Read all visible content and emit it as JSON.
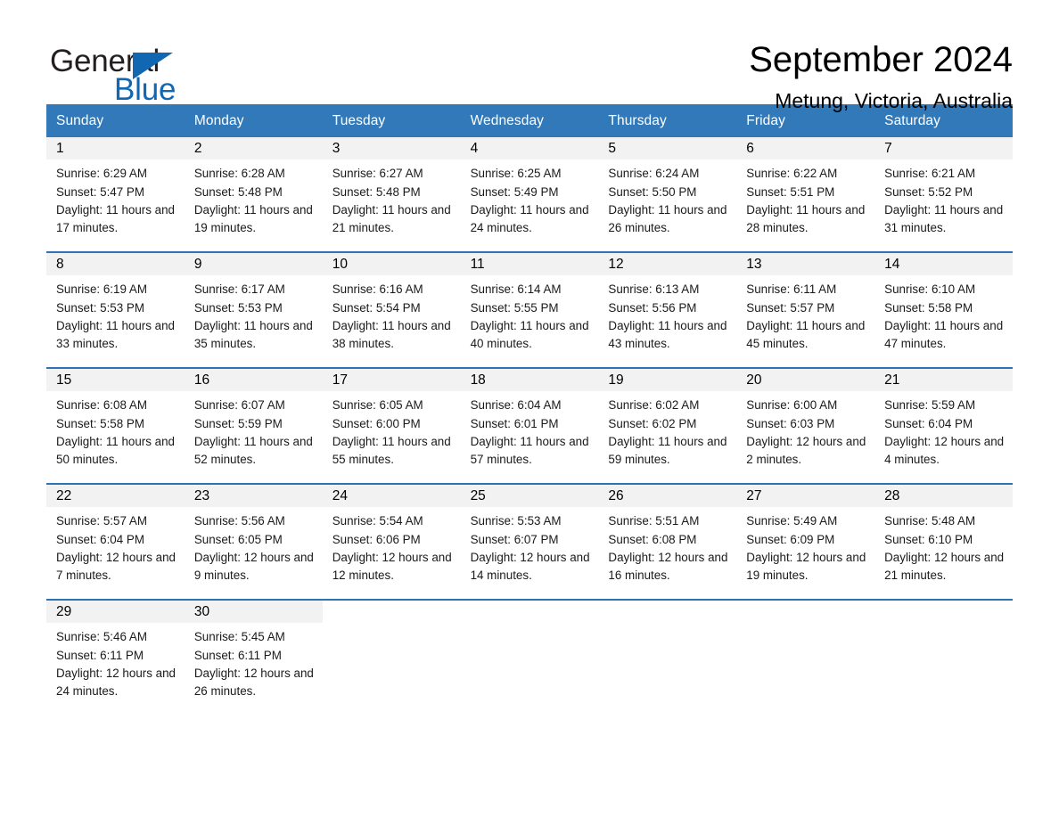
{
  "brand": {
    "name_part1": "General",
    "name_part2": "Blue",
    "triangle_color": "#1267b2"
  },
  "header": {
    "title": "September 2024",
    "location": "Metung, Victoria, Australia"
  },
  "theme": {
    "header_blue": "#3179b8",
    "row_border_blue": "#2e74b5",
    "date_band_gray": "#f2f2f2"
  },
  "calendar": {
    "weekdays": [
      "Sunday",
      "Monday",
      "Tuesday",
      "Wednesday",
      "Thursday",
      "Friday",
      "Saturday"
    ],
    "weeks": [
      [
        {
          "day": "1",
          "sunrise": "Sunrise: 6:29 AM",
          "sunset": "Sunset: 5:47 PM",
          "daylight": "Daylight: 11 hours and 17 minutes."
        },
        {
          "day": "2",
          "sunrise": "Sunrise: 6:28 AM",
          "sunset": "Sunset: 5:48 PM",
          "daylight": "Daylight: 11 hours and 19 minutes."
        },
        {
          "day": "3",
          "sunrise": "Sunrise: 6:27 AM",
          "sunset": "Sunset: 5:48 PM",
          "daylight": "Daylight: 11 hours and 21 minutes."
        },
        {
          "day": "4",
          "sunrise": "Sunrise: 6:25 AM",
          "sunset": "Sunset: 5:49 PM",
          "daylight": "Daylight: 11 hours and 24 minutes."
        },
        {
          "day": "5",
          "sunrise": "Sunrise: 6:24 AM",
          "sunset": "Sunset: 5:50 PM",
          "daylight": "Daylight: 11 hours and 26 minutes."
        },
        {
          "day": "6",
          "sunrise": "Sunrise: 6:22 AM",
          "sunset": "Sunset: 5:51 PM",
          "daylight": "Daylight: 11 hours and 28 minutes."
        },
        {
          "day": "7",
          "sunrise": "Sunrise: 6:21 AM",
          "sunset": "Sunset: 5:52 PM",
          "daylight": "Daylight: 11 hours and 31 minutes."
        }
      ],
      [
        {
          "day": "8",
          "sunrise": "Sunrise: 6:19 AM",
          "sunset": "Sunset: 5:53 PM",
          "daylight": "Daylight: 11 hours and 33 minutes."
        },
        {
          "day": "9",
          "sunrise": "Sunrise: 6:17 AM",
          "sunset": "Sunset: 5:53 PM",
          "daylight": "Daylight: 11 hours and 35 minutes."
        },
        {
          "day": "10",
          "sunrise": "Sunrise: 6:16 AM",
          "sunset": "Sunset: 5:54 PM",
          "daylight": "Daylight: 11 hours and 38 minutes."
        },
        {
          "day": "11",
          "sunrise": "Sunrise: 6:14 AM",
          "sunset": "Sunset: 5:55 PM",
          "daylight": "Daylight: 11 hours and 40 minutes."
        },
        {
          "day": "12",
          "sunrise": "Sunrise: 6:13 AM",
          "sunset": "Sunset: 5:56 PM",
          "daylight": "Daylight: 11 hours and 43 minutes."
        },
        {
          "day": "13",
          "sunrise": "Sunrise: 6:11 AM",
          "sunset": "Sunset: 5:57 PM",
          "daylight": "Daylight: 11 hours and 45 minutes."
        },
        {
          "day": "14",
          "sunrise": "Sunrise: 6:10 AM",
          "sunset": "Sunset: 5:58 PM",
          "daylight": "Daylight: 11 hours and 47 minutes."
        }
      ],
      [
        {
          "day": "15",
          "sunrise": "Sunrise: 6:08 AM",
          "sunset": "Sunset: 5:58 PM",
          "daylight": "Daylight: 11 hours and 50 minutes."
        },
        {
          "day": "16",
          "sunrise": "Sunrise: 6:07 AM",
          "sunset": "Sunset: 5:59 PM",
          "daylight": "Daylight: 11 hours and 52 minutes."
        },
        {
          "day": "17",
          "sunrise": "Sunrise: 6:05 AM",
          "sunset": "Sunset: 6:00 PM",
          "daylight": "Daylight: 11 hours and 55 minutes."
        },
        {
          "day": "18",
          "sunrise": "Sunrise: 6:04 AM",
          "sunset": "Sunset: 6:01 PM",
          "daylight": "Daylight: 11 hours and 57 minutes."
        },
        {
          "day": "19",
          "sunrise": "Sunrise: 6:02 AM",
          "sunset": "Sunset: 6:02 PM",
          "daylight": "Daylight: 11 hours and 59 minutes."
        },
        {
          "day": "20",
          "sunrise": "Sunrise: 6:00 AM",
          "sunset": "Sunset: 6:03 PM",
          "daylight": "Daylight: 12 hours and 2 minutes."
        },
        {
          "day": "21",
          "sunrise": "Sunrise: 5:59 AM",
          "sunset": "Sunset: 6:04 PM",
          "daylight": "Daylight: 12 hours and 4 minutes."
        }
      ],
      [
        {
          "day": "22",
          "sunrise": "Sunrise: 5:57 AM",
          "sunset": "Sunset: 6:04 PM",
          "daylight": "Daylight: 12 hours and 7 minutes."
        },
        {
          "day": "23",
          "sunrise": "Sunrise: 5:56 AM",
          "sunset": "Sunset: 6:05 PM",
          "daylight": "Daylight: 12 hours and 9 minutes."
        },
        {
          "day": "24",
          "sunrise": "Sunrise: 5:54 AM",
          "sunset": "Sunset: 6:06 PM",
          "daylight": "Daylight: 12 hours and 12 minutes."
        },
        {
          "day": "25",
          "sunrise": "Sunrise: 5:53 AM",
          "sunset": "Sunset: 6:07 PM",
          "daylight": "Daylight: 12 hours and 14 minutes."
        },
        {
          "day": "26",
          "sunrise": "Sunrise: 5:51 AM",
          "sunset": "Sunset: 6:08 PM",
          "daylight": "Daylight: 12 hours and 16 minutes."
        },
        {
          "day": "27",
          "sunrise": "Sunrise: 5:49 AM",
          "sunset": "Sunset: 6:09 PM",
          "daylight": "Daylight: 12 hours and 19 minutes."
        },
        {
          "day": "28",
          "sunrise": "Sunrise: 5:48 AM",
          "sunset": "Sunset: 6:10 PM",
          "daylight": "Daylight: 12 hours and 21 minutes."
        }
      ],
      [
        {
          "day": "29",
          "sunrise": "Sunrise: 5:46 AM",
          "sunset": "Sunset: 6:11 PM",
          "daylight": "Daylight: 12 hours and 24 minutes."
        },
        {
          "day": "30",
          "sunrise": "Sunrise: 5:45 AM",
          "sunset": "Sunset: 6:11 PM",
          "daylight": "Daylight: 12 hours and 26 minutes."
        },
        {
          "day": "",
          "sunrise": "",
          "sunset": "",
          "daylight": ""
        },
        {
          "day": "",
          "sunrise": "",
          "sunset": "",
          "daylight": ""
        },
        {
          "day": "",
          "sunrise": "",
          "sunset": "",
          "daylight": ""
        },
        {
          "day": "",
          "sunrise": "",
          "sunset": "",
          "daylight": ""
        },
        {
          "day": "",
          "sunrise": "",
          "sunset": "",
          "daylight": ""
        }
      ]
    ]
  }
}
